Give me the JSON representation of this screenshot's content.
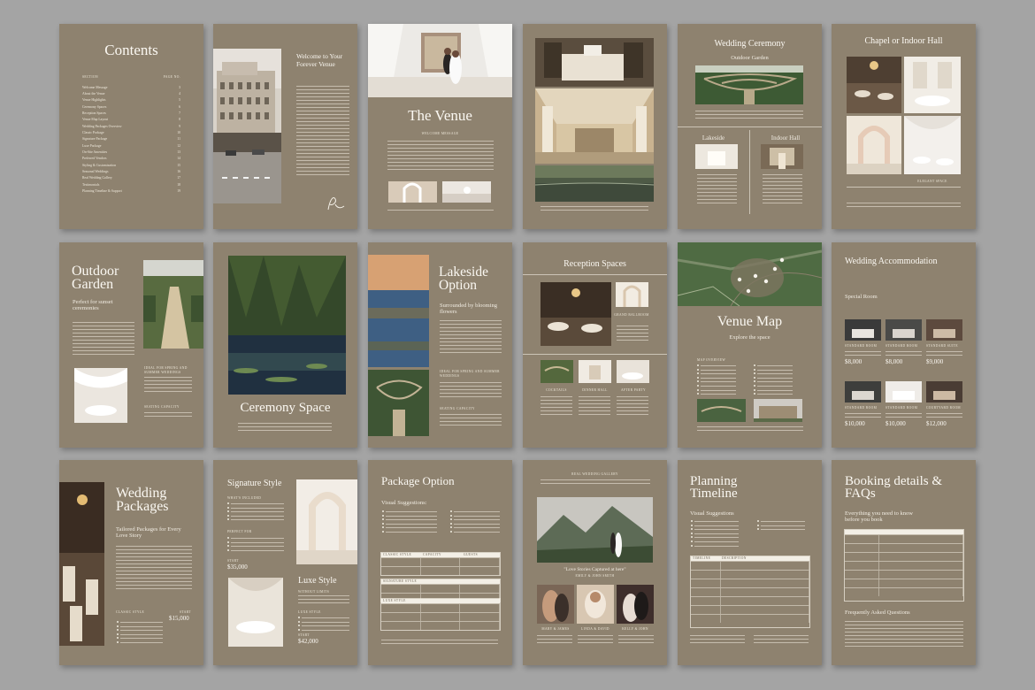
{
  "contents": {
    "title": "Contents",
    "col_section": "SECTION",
    "col_page": "PAGE NO.",
    "items": [
      {
        "label": "Welcome Message",
        "num": "3"
      },
      {
        "label": "About the Venue",
        "num": "4"
      },
      {
        "label": "Venue Highlights",
        "num": "5"
      },
      {
        "label": "Ceremony Spaces",
        "num": "6"
      },
      {
        "label": "Reception Spaces",
        "num": "7"
      },
      {
        "label": "Venue Map Layout",
        "num": "8"
      },
      {
        "label": "Wedding Packages Overview",
        "num": "9"
      },
      {
        "label": "Classic Package",
        "num": "10"
      },
      {
        "label": "Signature Package",
        "num": "11"
      },
      {
        "label": "Luxe Package",
        "num": "12"
      },
      {
        "label": "On-Site Amenities",
        "num": "13"
      },
      {
        "label": "Preferred Vendors",
        "num": "14"
      },
      {
        "label": "Styling & Customization",
        "num": "15"
      },
      {
        "label": "Seasonal Weddings",
        "num": "16"
      },
      {
        "label": "Real Wedding Gallery",
        "num": "17"
      },
      {
        "label": "Testimonials",
        "num": "18"
      },
      {
        "label": "Planning Timeline & Support",
        "num": "19"
      }
    ]
  },
  "welcome": {
    "title": "Welcome to Your Forever Venue"
  },
  "venue": {
    "title": "The Venue",
    "kicker": "WELCOME MESSAGE"
  },
  "ceremony": {
    "title": "Wedding Ceremony",
    "subtitle": "Outdoor Garden",
    "lakeside": "Lakeside",
    "indoor": "Indoor Hall"
  },
  "chapel": {
    "title": "Chapel or Indoor Hall",
    "caption": "ELEGANT SPACE"
  },
  "outdoor": {
    "title": "Outdoor Garden",
    "subtitle": "Perfect for sunset ceremonies",
    "ideal": "IDEAL FOR SPRING AND SUMMER WEDDINGS",
    "seating": "SEATING CAPACITY"
  },
  "ceremony_space": {
    "title": "Ceremony Space"
  },
  "lakeside": {
    "title": "Lakeside Option",
    "subtitle": "Surrounded by blooming flowers",
    "ideal": "IDEAL FOR SPRING AND SUMMER WEDDINGS",
    "seating": "SEATING CAPACITY"
  },
  "reception": {
    "title": "Reception Spaces",
    "grand": "GRAND BALLROOM",
    "labels": [
      "COCKTAILS",
      "DINNER HALL",
      "AFTER PARTY"
    ]
  },
  "map": {
    "title": "Venue Map",
    "subtitle": "Explore the space",
    "overview": "MAP OVERVIEW"
  },
  "accommodation": {
    "title": "Wedding Accommodation",
    "subtitle": "Special Room",
    "rooms": [
      {
        "name": "STANDARD ROOM",
        "price": "$8,000"
      },
      {
        "name": "STANDARD ROOM",
        "price": "$8,000"
      },
      {
        "name": "STANDARD SUITE",
        "price": "$9,000"
      },
      {
        "name": "STANDARD ROOM",
        "price": "$10,000"
      },
      {
        "name": "STANDARD ROOM",
        "price": "$10,000"
      },
      {
        "name": "COURTYARD ROOM",
        "price": "$12,000"
      }
    ]
  },
  "packages": {
    "title": "Wedding Packages",
    "subtitle": "Tailored Packages for Every Love Story",
    "classic": "CLASSIC STYLE",
    "start": "START",
    "price": "$15,000"
  },
  "signature": {
    "title": "Signature Style",
    "whats": "WHAT'S INCLUDED",
    "perfect": "PERFECT FOR",
    "start": "START",
    "price": "$35,000",
    "luxe": "Luxe Style",
    "luxe_sub": "WITHOUT LIMITS",
    "luxe_style": "LUXE STYLE",
    "luxe_start": "START",
    "luxe_price": "$42,000"
  },
  "package_option": {
    "title": "Package Option",
    "visual": "Visual Suggestions:",
    "t1": "CLASSIC STYLE",
    "t2": "SIGNATURE STYLE",
    "t3": "LUXE STYLE",
    "h2": "CAPACITY",
    "h3": "GUESTS"
  },
  "gallery": {
    "kicker": "REAL WEDDING GALLERY",
    "quote": "\"Love Stories Captured at here\"",
    "couple": "EMILY & JOHN SMITH",
    "names": [
      "MARY & JAMES",
      "LINDA & DAVID",
      "KELLY & JOHN"
    ]
  },
  "planning": {
    "title": "Planning Timeline",
    "visual": "Visual Suggestions",
    "h1": "TIMELINE",
    "h2": "DESCRIPTION"
  },
  "booking": {
    "title": "Booking details & FAQs",
    "subtitle": "Everything you need to know before you book",
    "faq": "Frequently Asked Questions"
  }
}
